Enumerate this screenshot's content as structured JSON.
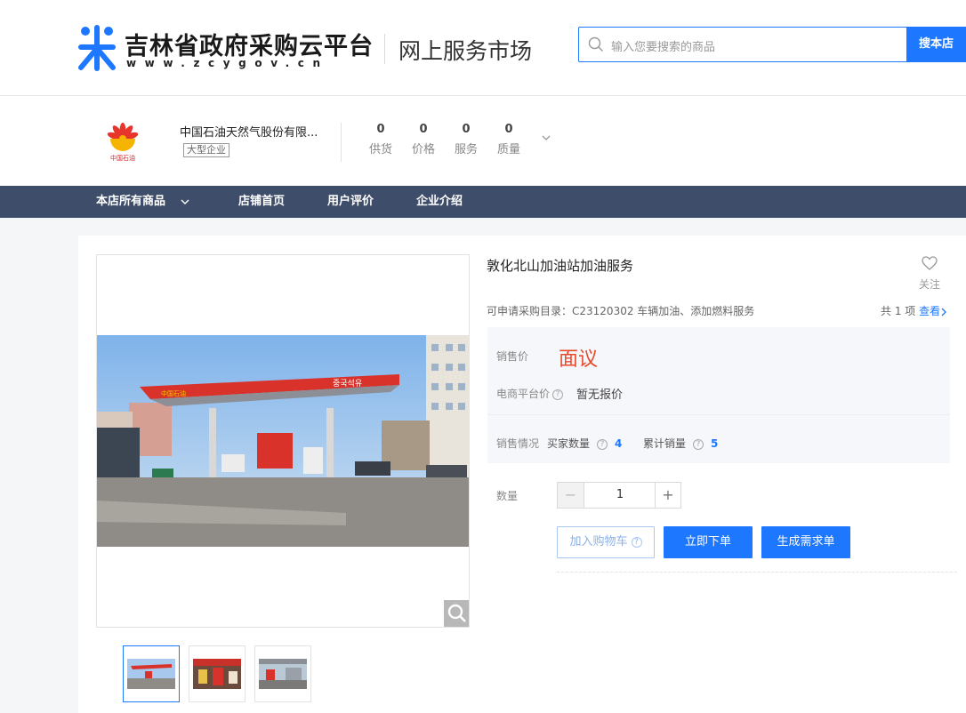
{
  "header": {
    "logo_title": "吉林省政府采购云平台",
    "logo_url": "www.zcygov.cn",
    "logo_sub": "网上服务市场",
    "search_placeholder": "输入您要搜索的商品",
    "search_button": "搜本店",
    "brand_color": "#1e78ff"
  },
  "store": {
    "name": "中国石油天然气股份有限...",
    "badge": "大型企业",
    "logo_caption": "中国石油",
    "stats": [
      {
        "value": "0",
        "label": "供货"
      },
      {
        "value": "0",
        "label": "价格"
      },
      {
        "value": "0",
        "label": "服务"
      },
      {
        "value": "0",
        "label": "质量"
      }
    ]
  },
  "nav": {
    "items": [
      "本店所有商品",
      "店铺首页",
      "用户评价",
      "企业介绍"
    ],
    "bg_color": "#3e4d69"
  },
  "product": {
    "title": "敦化北山加油站加油服务",
    "fav_label": "关注",
    "catalog_label": "可申请采购目录：",
    "catalog_value": "C23120302 车辆加油、添加燃料服务",
    "catalog_count": "共 1 项",
    "catalog_link": "查看",
    "canopy_sign": "중국석유",
    "canopy_logo": "中国石油",
    "price_label": "销售价",
    "price_value": "面议",
    "ecom_label": "电商平台价",
    "ecom_value": "暂无报价",
    "sales_label": "销售情况",
    "buyers_label": "买家数量",
    "buyers_value": "4",
    "total_label": "累计销量",
    "total_value": "5",
    "qty_label": "数量",
    "qty_value": "1",
    "btn_cart": "加入购物车",
    "btn_order": "立即下单",
    "btn_demand": "生成需求单",
    "price_color": "#e84a2a"
  }
}
